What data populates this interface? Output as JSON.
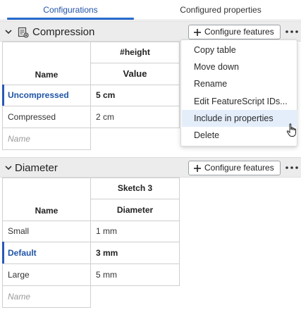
{
  "tabs": [
    {
      "label": "Configurations",
      "active": true
    },
    {
      "label": "Configured properties",
      "active": false
    }
  ],
  "sections": [
    {
      "title": "Compression",
      "icon": "configuration-table-icon",
      "configure_label": "Configure features",
      "feature_header": "#height",
      "column_header": "Value",
      "name_header": "Name",
      "rows": [
        {
          "name": "Uncompressed",
          "value": "5 cm",
          "default": true
        },
        {
          "name": "Compressed",
          "value": "2 cm",
          "default": false
        }
      ],
      "new_row_placeholder": "Name"
    },
    {
      "title": "Diameter",
      "configure_label": "Configure features",
      "feature_header": "Sketch 3",
      "column_header": "Diameter",
      "name_header": "Name",
      "rows": [
        {
          "name": "Small",
          "value": "1 mm",
          "default": false
        },
        {
          "name": "Default",
          "value": "3 mm",
          "default": true
        },
        {
          "name": "Large",
          "value": "5 mm",
          "default": false
        }
      ],
      "new_row_placeholder": "Name"
    }
  ],
  "context_menu": {
    "items": [
      "Copy table",
      "Move down",
      "Rename",
      "Edit FeatureScript IDs...",
      "Include in properties",
      "Delete"
    ],
    "highlighted": "Include in properties"
  },
  "colors": {
    "accent": "#2a6acf",
    "default_row_text": "#2054a8",
    "header_bg": "#ececec",
    "menu_highlight": "#e4eefa"
  }
}
